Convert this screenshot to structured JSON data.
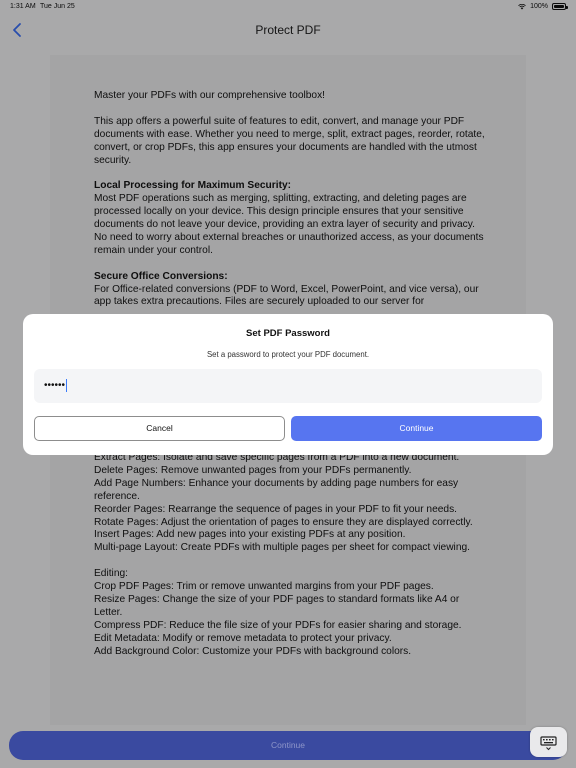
{
  "status_bar": {
    "time": "1:31 AM",
    "date": "Tue Jun 25",
    "battery": "100%"
  },
  "nav": {
    "title": "Protect PDF",
    "back_icon": "chevron-left-icon"
  },
  "document": {
    "intro": "Master your PDFs with our comprehensive toolbox!",
    "overview": "This app offers a powerful suite of features to edit, convert, and manage your PDF documents with ease. Whether you need to merge, split, extract pages, reorder, rotate, convert, or crop PDFs, this app ensures your documents are handled with the utmost security.",
    "section1_heading": "Local Processing for Maximum Security:",
    "section1_body": "Most PDF operations such as merging, splitting, extracting, and deleting pages are processed locally on your device. This design principle ensures that your sensitive documents do not leave your device, providing an extra layer of security and privacy. No need to worry about external breaches or unauthorized access, as your documents remain under your control.",
    "section2_heading": "Secure Office Conversions:",
    "section2_body": "For Office-related conversions (PDF to Word, Excel, PowerPoint, and vice versa), our app takes extra precautions. Files are securely uploaded to our server for",
    "pages_lines": [
      "Extract Pages: Isolate and save specific pages from a PDF into a new document.",
      "Delete Pages: Remove unwanted pages from your PDFs permanently.",
      "Add Page Numbers: Enhance your documents by adding page numbers for easy reference.",
      "Reorder Pages: Rearrange the sequence of pages in your PDF to fit your needs.",
      "Rotate Pages: Adjust the orientation of pages to ensure they are displayed correctly.",
      "Insert Pages: Add new pages into your existing PDFs at any position.",
      "Multi-page Layout: Create PDFs with multiple pages per sheet for compact viewing."
    ],
    "editing_heading": "Editing:",
    "editing_lines": [
      "Crop PDF Pages: Trim or remove unwanted margins from your PDF pages.",
      "Resize Pages: Change the size of your PDF pages to standard formats like A4 or Letter.",
      "Compress PDF: Reduce the file size of your PDFs for easier sharing and storage.",
      "Edit Metadata: Modify or remove metadata to protect your privacy.",
      "Add Background Color: Customize your PDFs with background colors."
    ]
  },
  "dialog": {
    "title": "Set PDF Password",
    "subtitle": "Set a password to protect your PDF document.",
    "password_value": "••••••",
    "cancel_label": "Cancel",
    "continue_label": "Continue"
  },
  "bottom": {
    "continue_label": "Continue",
    "keyboard_icon": "keyboard-icon"
  },
  "colors": {
    "accent": "#5775f0",
    "bottom_button": "#3a4aa0"
  }
}
